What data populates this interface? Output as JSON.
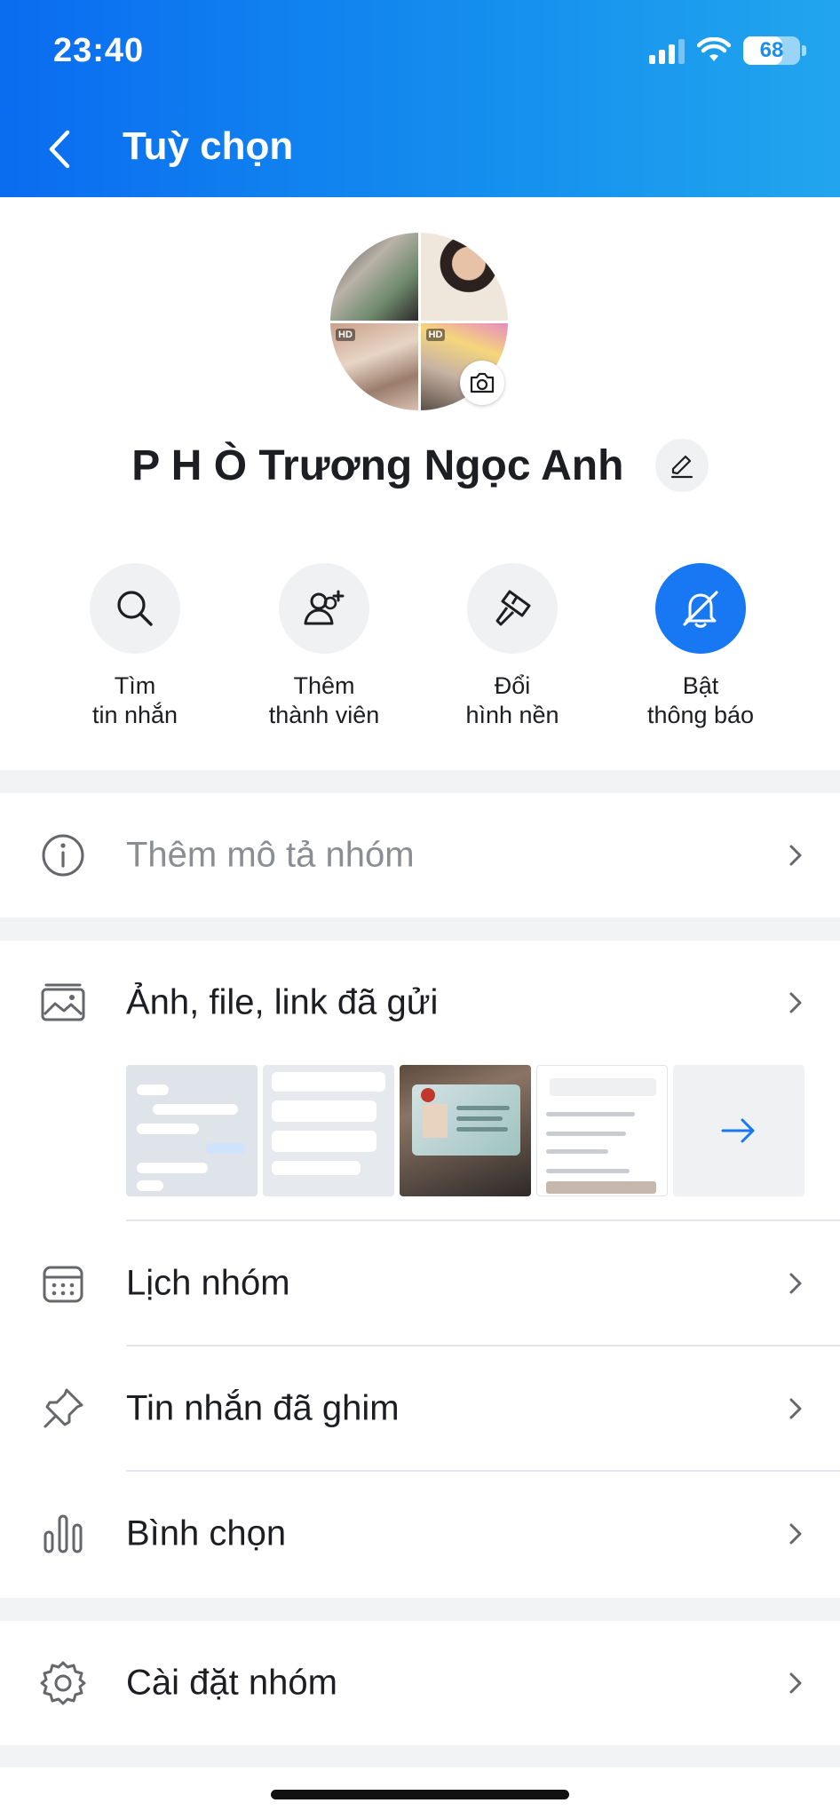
{
  "status_bar": {
    "time": "23:40",
    "battery": "68",
    "battery_level": 0.68
  },
  "header": {
    "title": "Tuỳ chọn"
  },
  "profile": {
    "group_name": "P H Ò Trương Ngọc Anh",
    "avatar_badge": "HD"
  },
  "actions": [
    {
      "line1": "Tìm",
      "line2": "tin nhắn",
      "icon": "search-icon"
    },
    {
      "line1": "Thêm",
      "line2": "thành viên",
      "icon": "add-member-icon"
    },
    {
      "line1": "Đổi",
      "line2": "hình nền",
      "icon": "paint-brush-icon"
    },
    {
      "line1": "Bật",
      "line2": "thông báo",
      "icon": "bell-off-icon"
    }
  ],
  "rows": {
    "description": "Thêm mô tả nhóm",
    "media": "Ảnh, file, link đã gửi",
    "calendar": "Lịch nhóm",
    "pinned": "Tin nhắn đã ghim",
    "poll": "Bình chọn",
    "settings": "Cài đặt nhóm"
  },
  "colors": {
    "header_start": "#0a6cf0",
    "header_end": "#22a5ee",
    "accent": "#1877f2"
  }
}
